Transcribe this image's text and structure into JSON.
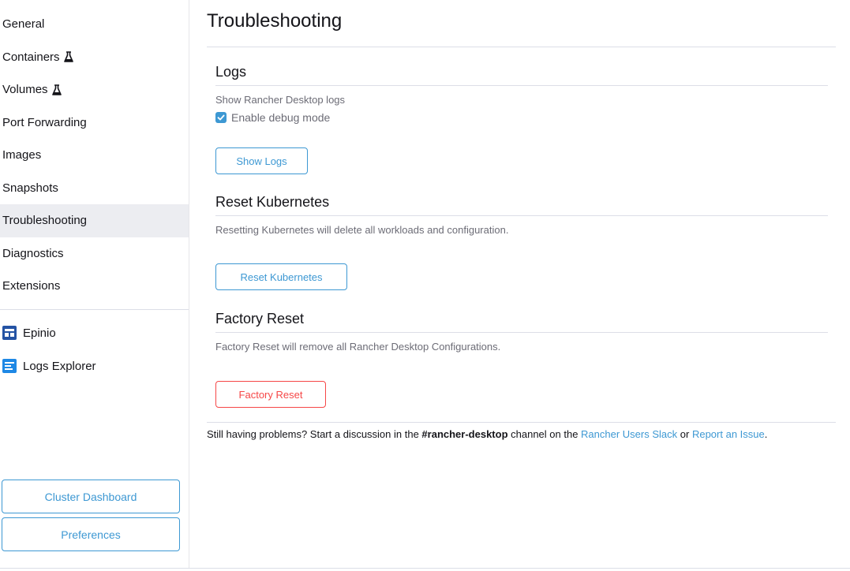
{
  "sidebar": {
    "items": [
      {
        "label": "General",
        "experimental": false
      },
      {
        "label": "Containers",
        "experimental": true
      },
      {
        "label": "Volumes",
        "experimental": true
      },
      {
        "label": "Port Forwarding",
        "experimental": false
      },
      {
        "label": "Images",
        "experimental": false
      },
      {
        "label": "Snapshots",
        "experimental": false
      },
      {
        "label": "Troubleshooting",
        "experimental": false,
        "active": true
      },
      {
        "label": "Diagnostics",
        "experimental": false
      },
      {
        "label": "Extensions",
        "experimental": false
      }
    ],
    "extensions": [
      {
        "label": "Epinio",
        "icon": "epinio-icon"
      },
      {
        "label": "Logs Explorer",
        "icon": "logs-explorer-icon"
      }
    ],
    "cluster_dashboard_label": "Cluster Dashboard",
    "preferences_label": "Preferences"
  },
  "main": {
    "title": "Troubleshooting",
    "logs": {
      "title": "Logs",
      "description": "Show Rancher Desktop logs",
      "debug_label": "Enable debug mode",
      "debug_checked": true,
      "button_label": "Show Logs"
    },
    "reset_kubernetes": {
      "title": "Reset Kubernetes",
      "description": "Resetting Kubernetes will delete all workloads and configuration.",
      "button_label": "Reset Kubernetes"
    },
    "factory_reset": {
      "title": "Factory Reset",
      "description": "Factory Reset will remove all Rancher Desktop Configurations.",
      "button_label": "Factory Reset"
    },
    "footer": {
      "prefix": "Still having problems? Start a discussion in the ",
      "channel": "#rancher-desktop",
      "middle": " channel on the ",
      "slack_link": "Rancher Users Slack",
      "or": " or ",
      "issue_link": "Report an Issue",
      "suffix": "."
    }
  },
  "colors": {
    "accent": "#3d98d3",
    "danger": "#f64747",
    "active_bg": "#ecedf1"
  }
}
